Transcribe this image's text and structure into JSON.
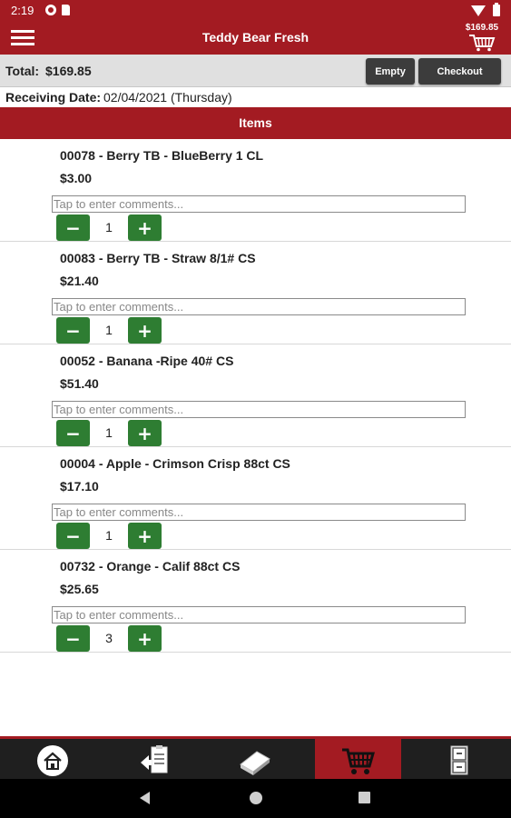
{
  "status_bar": {
    "time": "2:19"
  },
  "app_bar": {
    "title": "Teddy Bear Fresh",
    "cart_amount": "$169.85"
  },
  "summary": {
    "total_label": "Total:",
    "total_value": "$169.85",
    "empty_label": "Empty",
    "checkout_label": "Checkout",
    "receiving_label": "Receiving Date:",
    "receiving_value": "02/04/2021 (Thursday)"
  },
  "section_title": "Items",
  "comment_placeholder": "Tap to enter comments...",
  "items": [
    {
      "name": "00078 - Berry TB - BlueBerry 1 CL",
      "price": "$3.00",
      "qty": "1"
    },
    {
      "name": "00083 - Berry TB - Straw 8/1# CS",
      "price": "$21.40",
      "qty": "1"
    },
    {
      "name": "00052 - Banana -Ripe 40# CS",
      "price": "$51.40",
      "qty": "1"
    },
    {
      "name": "00004 - Apple - Crimson Crisp 88ct CS",
      "price": "$17.10",
      "qty": "1"
    },
    {
      "name": "00732 - Orange - Calif 88ct CS",
      "price": "$25.65",
      "qty": "3"
    }
  ],
  "stepper": {
    "minus": "−",
    "plus": "+"
  },
  "bottom_nav": [
    {
      "icon": "home-icon"
    },
    {
      "icon": "clipboard-icon"
    },
    {
      "icon": "book-icon"
    },
    {
      "icon": "cart-icon",
      "active": true
    },
    {
      "icon": "cabinet-icon"
    }
  ],
  "colors": {
    "brand_red": "#a31b22",
    "stepper_green": "#2e7d32",
    "button_dark": "#3c3c3c"
  }
}
